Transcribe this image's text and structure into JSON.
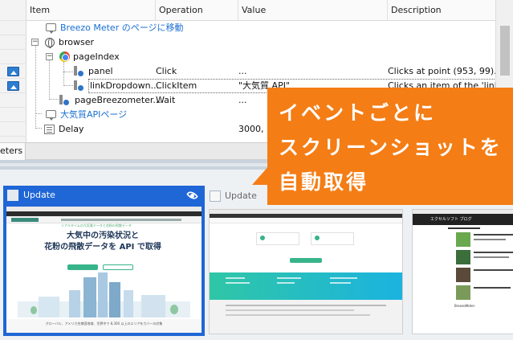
{
  "grid": {
    "headers": {
      "item": "Item",
      "operation": "Operation",
      "value": "Value",
      "description": "Description"
    },
    "rows": [
      {
        "item": "Breezo Meter のページに移動",
        "operation": "",
        "value": "",
        "description": "",
        "link": true
      },
      {
        "item": "browser",
        "operation": "",
        "value": "",
        "description": ""
      },
      {
        "item": "pageIndex",
        "operation": "",
        "value": "",
        "description": ""
      },
      {
        "item": "panel",
        "operation": "Click",
        "value": "...",
        "description": "Clicks at point (953, 99)..."
      },
      {
        "item": "linkDropdown...",
        "operation": "ClickItem",
        "value": "\"大気質 API\"",
        "description": "Clicks an item of the 'link..."
      },
      {
        "item": "pageBreezometer...",
        "operation": "Wait",
        "value": "...",
        "description": ""
      },
      {
        "item": "大気質APIページ",
        "operation": "",
        "value": "",
        "description": "",
        "link": true
      },
      {
        "item": "Delay",
        "operation": "",
        "value": "3000, \"",
        "description": ""
      }
    ]
  },
  "tabstrip": {
    "tab_label": "eters"
  },
  "thumbnails": [
    {
      "title": "Update",
      "active": true
    },
    {
      "title": "Update",
      "active": false
    },
    {
      "title": "",
      "active": false
    }
  ],
  "shot1": {
    "banner": "リアルタイムの大気質データと花粉の飛散データ",
    "headline": "大気中の汚染状況と\n花粉の飛散データを API で取得",
    "footer": "グローバル、アメリカ合衆国地域、世界中で 8,300 以上のエリアをカバーの対象"
  },
  "shot3": {
    "title": "エクセルソフト ブログ",
    "brand": "BreezoMeter"
  },
  "callout": {
    "text": "イベントごとに\nスクリーンショットを\n自動取得"
  },
  "colors": {
    "accent": "#1f66d6",
    "callout": "#f47d15",
    "link": "#1a6fd1"
  }
}
